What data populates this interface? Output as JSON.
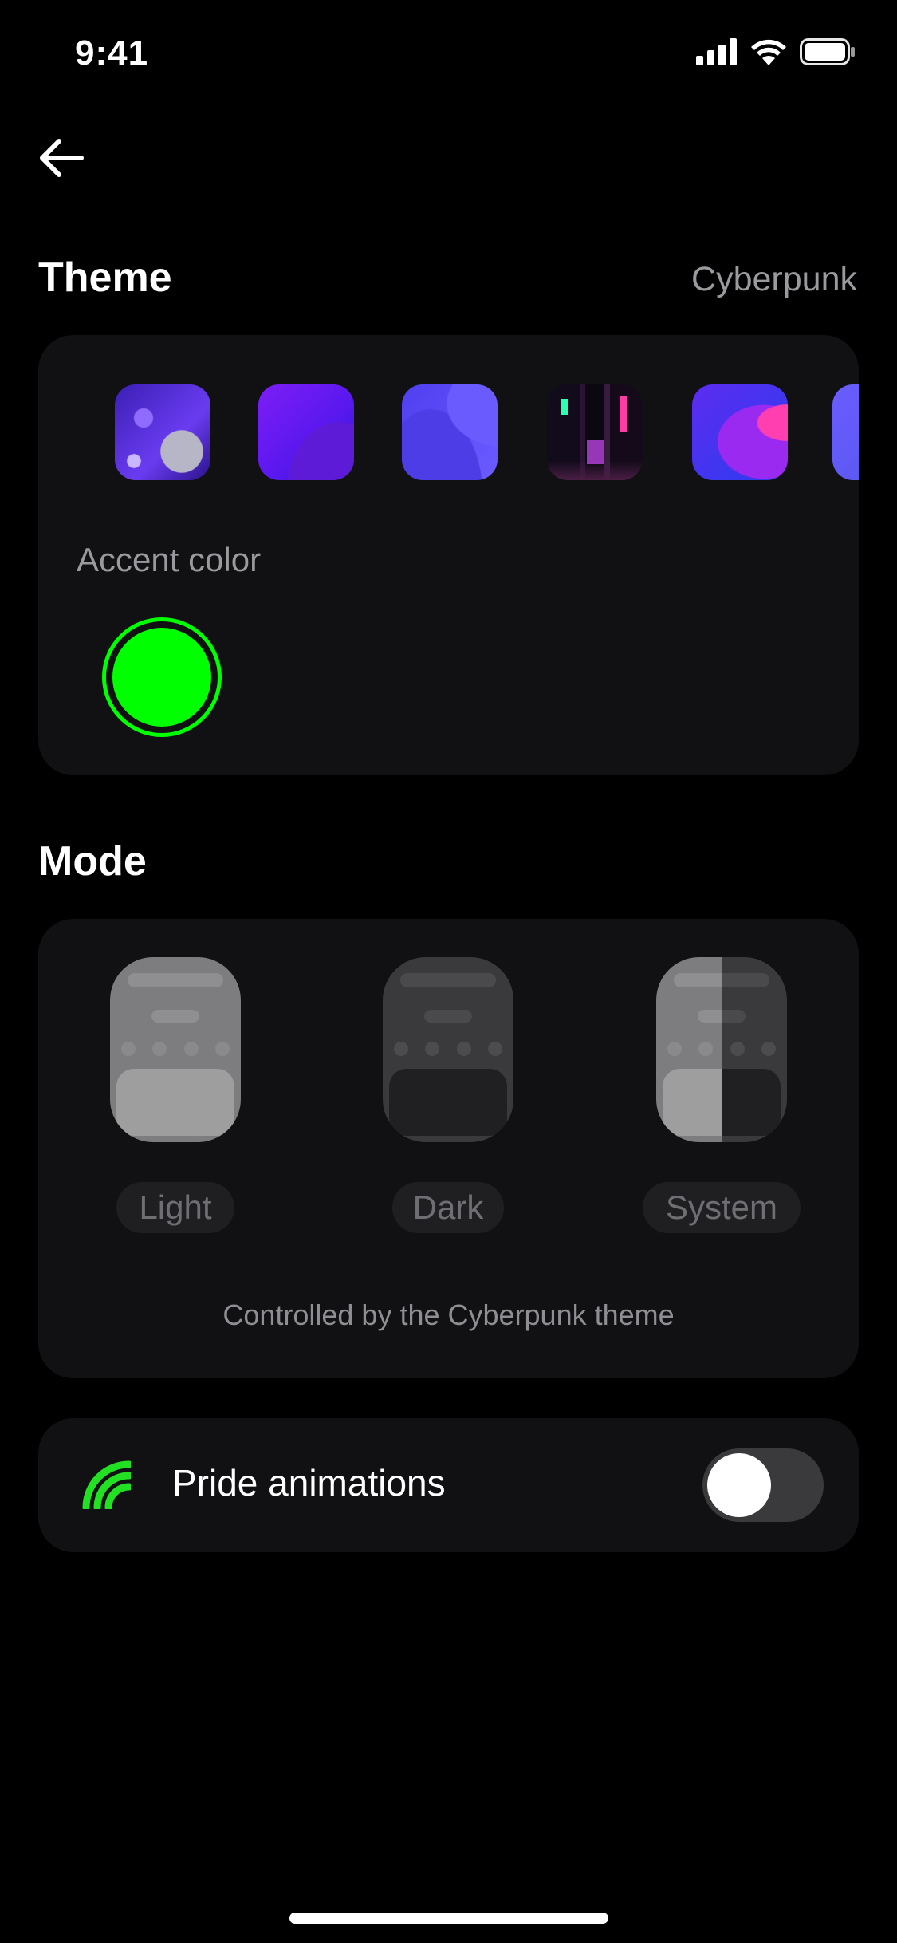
{
  "status_bar": {
    "time": "9:41"
  },
  "header": {
    "back_icon": "arrow-left-icon"
  },
  "theme": {
    "title": "Theme",
    "current": "Cyberpunk",
    "thumbnails": [
      {
        "name": "theme-disco"
      },
      {
        "name": "theme-violet-wave"
      },
      {
        "name": "theme-blue-wave"
      },
      {
        "name": "theme-cyberpunk",
        "selected": true
      },
      {
        "name": "theme-gradient-bloom"
      },
      {
        "name": "theme-periwinkle"
      }
    ],
    "accent_label": "Accent color",
    "accent_color": "#00FF00"
  },
  "mode": {
    "title": "Mode",
    "options": [
      {
        "label": "Light"
      },
      {
        "label": "Dark"
      },
      {
        "label": "System"
      }
    ],
    "note": "Controlled by the Cyberpunk theme"
  },
  "pride": {
    "label": "Pride animations",
    "icon": "rainbow-icon",
    "enabled": false
  }
}
